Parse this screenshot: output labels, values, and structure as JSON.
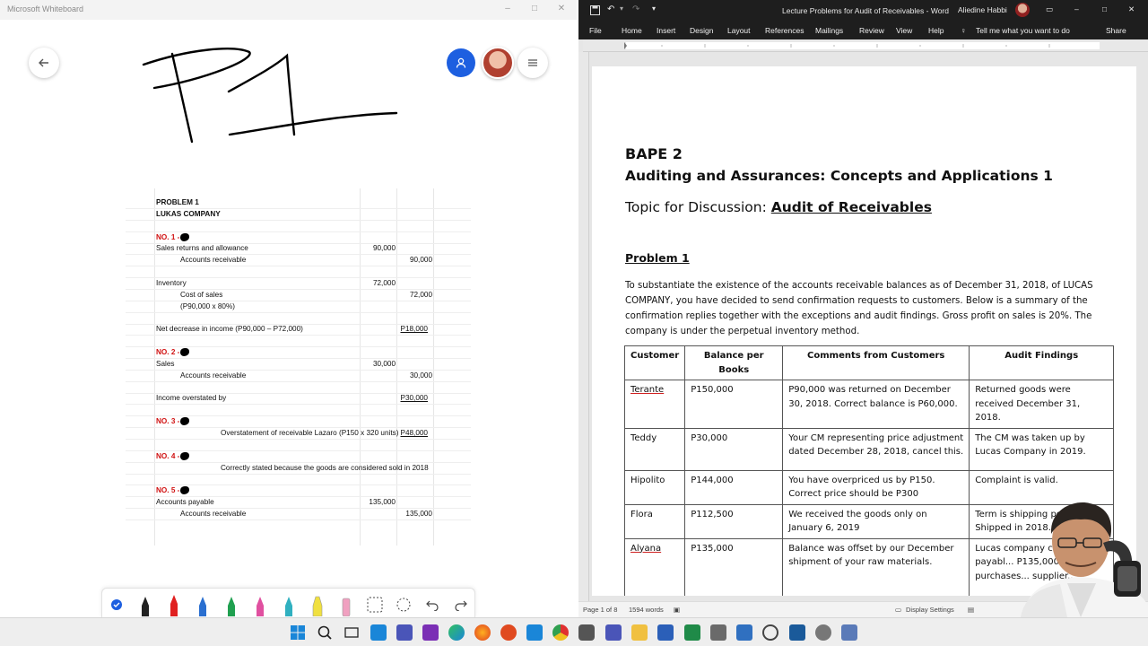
{
  "whiteboard": {
    "window_title": "Microsoft Whiteboard",
    "handwriting": "P1",
    "sheet": {
      "rows": [
        {
          "label": "PROBLEM 1",
          "indent": 0,
          "bold": true
        },
        {
          "label": "LUKAS COMPANY",
          "indent": 0,
          "bold": true
        },
        {
          "label": "",
          "indent": 0
        },
        {
          "label": "NO. 1 -",
          "indent": 0,
          "red": true,
          "mark": true
        },
        {
          "label": "Sales returns and allowance",
          "indent": 0,
          "debit": "90,000"
        },
        {
          "label": "Accounts receivable",
          "indent": 2,
          "credit": "90,000"
        },
        {
          "label": "",
          "indent": 0
        },
        {
          "label": "Inventory",
          "indent": 0,
          "debit": "72,000"
        },
        {
          "label": "Cost of sales",
          "indent": 2,
          "credit": "72,000"
        },
        {
          "label": "(P90,000 x 80%)",
          "indent": 2
        },
        {
          "label": "",
          "indent": 0
        },
        {
          "label": "Net decrease in income (P90,000 – P72,000)",
          "indent": 0,
          "total": "P18,000"
        },
        {
          "label": "",
          "indent": 0
        },
        {
          "label": "NO. 2 -",
          "indent": 0,
          "red": true,
          "mark": true
        },
        {
          "label": "Sales",
          "indent": 0,
          "debit": "30,000"
        },
        {
          "label": "Accounts receivable",
          "indent": 2,
          "credit": "30,000"
        },
        {
          "label": "",
          "indent": 0
        },
        {
          "label": "Income overstated by",
          "indent": 0,
          "total": "P30,000"
        },
        {
          "label": "",
          "indent": 0
        },
        {
          "label": "NO. 3 -",
          "indent": 0,
          "red": true,
          "mark": true
        },
        {
          "label": "Overstatement of receivable Lazaro (P150 x 320 units)",
          "indent": 1,
          "total": "P48,000"
        },
        {
          "label": "",
          "indent": 0
        },
        {
          "label": "NO. 4 -",
          "indent": 0,
          "red": true,
          "mark": true
        },
        {
          "label": "Correctly stated because the goods are considered sold in 2018",
          "indent": 1
        },
        {
          "label": "",
          "indent": 0
        },
        {
          "label": "NO. 5 -",
          "indent": 0,
          "red": true,
          "mark": true
        },
        {
          "label": "Accounts payable",
          "indent": 0,
          "debit": "135,000"
        },
        {
          "label": "Accounts receivable",
          "indent": 2,
          "credit": "135,000"
        }
      ]
    }
  },
  "word": {
    "window_title": "Lecture Problems for Audit of Receivables - Word",
    "user_name": "Aliedine Habbi",
    "tabs": [
      "File",
      "Home",
      "Insert",
      "Design",
      "Layout",
      "References",
      "Mailings",
      "Review",
      "View",
      "Help"
    ],
    "tell_me": "Tell me what you want to do",
    "share": "Share",
    "document": {
      "course": "BAPE 2",
      "subject": "Auditing and Assurances: Concepts and Applications 1",
      "topic_prefix": "Topic for Discussion: ",
      "topic": "Audit of Receivables",
      "problem_heading": "Problem 1",
      "paragraph": "To substantiate the existence of the accounts receivable balances as of December 31, 2018, of LUCAS COMPANY, you have decided to send confirmation requests to customers. Below is a summary of the confirmation replies together with the exceptions and audit findings. Gross profit on sales is 20%. The company is under the perpetual inventory method.",
      "table": {
        "headers": [
          "Customer",
          "Balance per Books",
          "Comments from Customers",
          "Audit Findings"
        ],
        "rows": [
          [
            "Terante",
            "P150,000",
            "P90,000 was returned on December 30, 2018. Correct balance is P60,000.",
            "Returned goods were received December 31, 2018."
          ],
          [
            "Teddy",
            "P30,000",
            "Your CM representing price adjustment dated December 28, 2018, cancel this.",
            "The CM was taken up by Lucas Company in 2019."
          ],
          [
            "Hipolito",
            "P144,000",
            "You have overpriced us by P150. Correct price should be P300",
            "Complaint is valid."
          ],
          [
            "Flora",
            "P112,500",
            "We received the goods only on January 6, 2019",
            "Term is shipping point. Shipped in 2018."
          ],
          [
            "Alyana",
            "P135,000",
            "Balance was offset by our December shipment of your raw materials.",
            "Lucas company c... accounts payabl... P135,000 to re... purchases... supplier..."
          ]
        ]
      }
    },
    "status": {
      "page": "Page 1 of 8",
      "words": "1594 words",
      "display_settings": "Display Settings"
    }
  },
  "colors": {
    "accent_blue": "#1d5fe0",
    "red_label": "#d01010",
    "word_titlebar": "#1e1e1e"
  }
}
